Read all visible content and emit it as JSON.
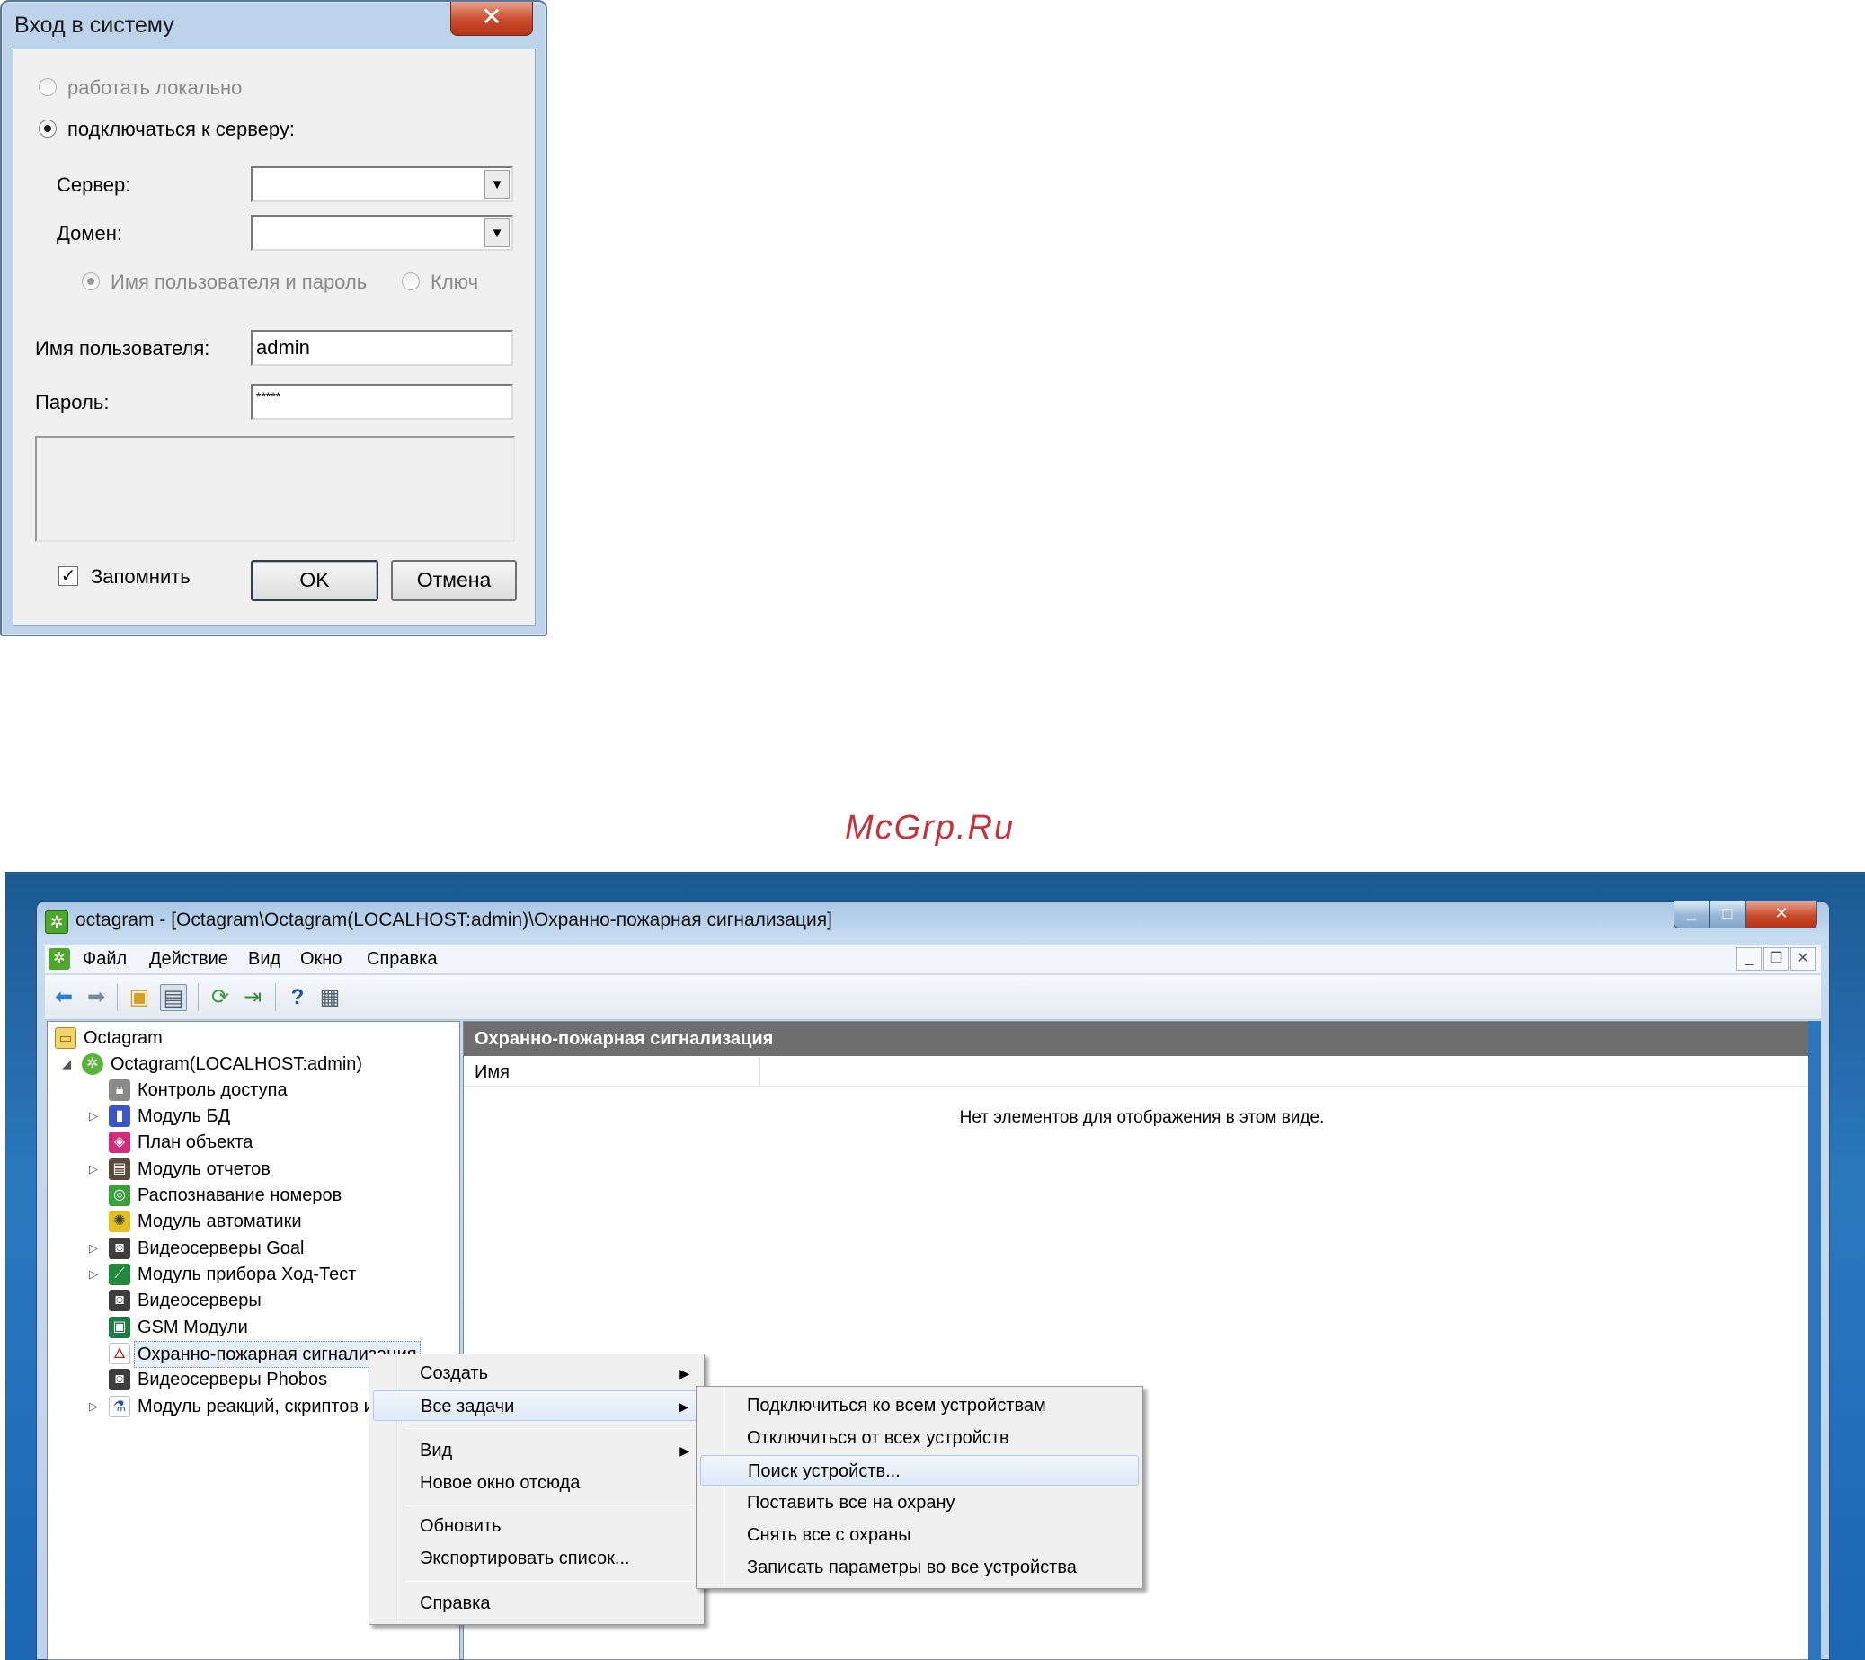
{
  "login": {
    "title": "Вход в систему",
    "close_glyph": "✕",
    "radio_local": "работать локально",
    "radio_server": "подключаться к серверу:",
    "server_label": "Сервер:",
    "server_value": "",
    "domain_label": "Домен:",
    "domain_value": "",
    "auth_userpass": "Имя пользователя и пароль",
    "auth_key": "Ключ",
    "username_label": "Имя пользователя:",
    "username_value": "admin",
    "password_label": "Пароль:",
    "password_value": "*****",
    "remember_label": "Запомнить",
    "remember_checked": true,
    "ok_label": "OK",
    "cancel_label": "Отмена"
  },
  "watermark": "McGrp.Ru",
  "mmc": {
    "title": "octagram - [Octagram\\Octagram(LOCALHOST:admin)\\Охранно-пожарная сигнализация]",
    "caption_min": "_",
    "caption_max": "□",
    "caption_close": "✕",
    "menu": [
      "Файл",
      "Действие",
      "Вид",
      "Окно",
      "Справка"
    ],
    "mdi_min": "_",
    "mdi_restore": "❐",
    "mdi_close": "✕",
    "tree": [
      {
        "label": "Octagram",
        "icon": "folder-icon"
      },
      {
        "label": "Octagram(LOCALHOST:admin)",
        "icon": "octagram-server-icon"
      },
      {
        "label": "Контроль доступа",
        "icon": "lock-icon"
      },
      {
        "label": "Модуль БД",
        "icon": "database-icon"
      },
      {
        "label": "План объекта",
        "icon": "plan-icon"
      },
      {
        "label": "Модуль отчетов",
        "icon": "reports-icon"
      },
      {
        "label": "Распознавание номеров",
        "icon": "plate-recognition-icon"
      },
      {
        "label": "Модуль автоматики",
        "icon": "automation-icon"
      },
      {
        "label": "Видеосерверы Goal",
        "icon": "camera-icon"
      },
      {
        "label": "Модуль прибора Ход-Тест",
        "icon": "test-device-icon"
      },
      {
        "label": "Видеосерверы",
        "icon": "camera-icon"
      },
      {
        "label": "GSM Модули",
        "icon": "gsm-icon"
      },
      {
        "label": "Охранно-пожарная сигнализация",
        "icon": "fire-alarm-icon"
      },
      {
        "label": "Видеосерверы Phobos",
        "icon": "camera-icon"
      },
      {
        "label": "Модуль реакций, скриптов и",
        "icon": "scripts-icon"
      }
    ],
    "result_header": "Охранно-пожарная сигнализация",
    "column_name": "Имя",
    "empty_message": "Нет элементов для отображения в этом виде.",
    "context_menu": {
      "create": "Создать",
      "all_tasks": "Все задачи",
      "view": "Вид",
      "new_window": "Новое окно отсюда",
      "refresh": "Обновить",
      "export": "Экспортировать список...",
      "help": "Справка"
    },
    "submenu": [
      "Подключиться ко всем устройствам",
      "Отключиться от всех устройств",
      "Поиск устройств...",
      "Поставить все на охрану",
      "Снять все с охраны",
      "Записать параметры во все устройства"
    ]
  }
}
